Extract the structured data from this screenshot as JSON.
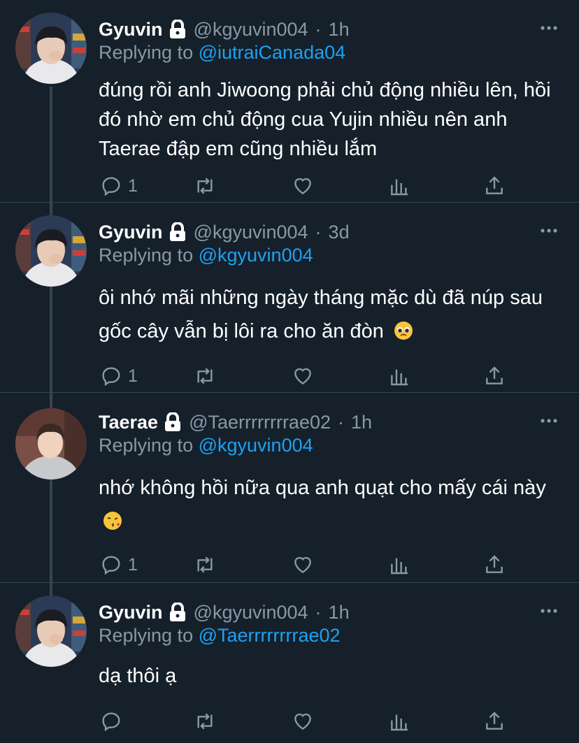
{
  "colors": {
    "background": "#15202b",
    "text": "#ffffff",
    "muted": "#8899a6",
    "link": "#1da1f2",
    "line": "#38444d"
  },
  "tweets": [
    {
      "name": "Gyuvin",
      "handle": "@kgyuvin004",
      "separator": "·",
      "time": "1h",
      "replying_prefix": "Replying to",
      "replying_to": "@iutraiCanada04",
      "text": "đúng rồi anh Jiwoong phải chủ động nhiều lên, hồi đó nhờ em chủ động cua Yujin nhiều nên anh Taerae đập em cũng nhiều lắm",
      "emoji": "",
      "reply_count": "1",
      "avatar_icon": "avatar-gyuvin"
    },
    {
      "name": "Gyuvin",
      "handle": "@kgyuvin004",
      "separator": "·",
      "time": "3d",
      "replying_prefix": "Replying to",
      "replying_to": "@kgyuvin004",
      "text": "ôi nhớ mãi những ngày tháng mặc dù đã núp sau gốc cây vẫn bị lôi ra cho ăn đòn",
      "emoji": "pleading-face",
      "reply_count": "1",
      "avatar_icon": "avatar-gyuvin"
    },
    {
      "name": "Taerae",
      "handle": "@Taerrrrrrrrae02",
      "separator": "·",
      "time": "1h",
      "replying_prefix": "Replying to",
      "replying_to": "@kgyuvin004",
      "text": "nhớ không hồi nữa qua anh quạt cho mấy cái này",
      "emoji": "kissing-face",
      "reply_count": "1",
      "avatar_icon": "avatar-taerae"
    },
    {
      "name": "Gyuvin",
      "handle": "@kgyuvin004",
      "separator": "·",
      "time": "1h",
      "replying_prefix": "Replying to",
      "replying_to": "@Taerrrrrrrrae02",
      "text": "dạ thôi ạ",
      "emoji": "",
      "reply_count": "",
      "avatar_icon": "avatar-gyuvin"
    }
  ]
}
